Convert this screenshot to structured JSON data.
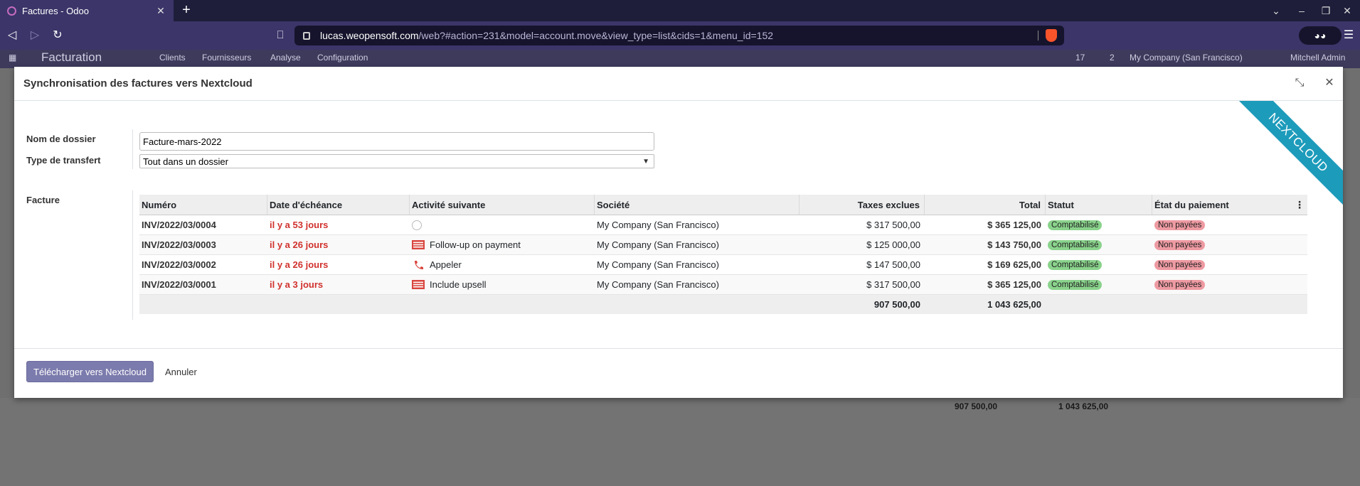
{
  "browser": {
    "tab_title": "Factures - Odoo",
    "url_host": "lucas.weopensoft.com",
    "url_path": "/web?#action=231&model=account.move&view_type=list&cids=1&menu_id=152"
  },
  "background": {
    "app_title": "Facturation",
    "menu": [
      "Clients",
      "Fournisseurs",
      "Analyse",
      "Configuration"
    ],
    "company": "My Company (San Francisco)",
    "user": "Mitchell Admin",
    "badge_activities": "17",
    "badge_messages": "2",
    "total_untaxed": "907 500,00",
    "total": "1 043 625,00"
  },
  "dialog": {
    "title": "Synchronisation des factures vers Nextcloud",
    "ribbon": "NEXTCLOUD",
    "folder_label": "Nom de dossier",
    "folder_value": "Facture-mars-2022",
    "transfer_label": "Type de transfert",
    "transfer_value": "Tout dans un dossier",
    "invoice_label": "Facture",
    "upload_button": "Télécharger vers Nextcloud",
    "cancel_button": "Annuler"
  },
  "table": {
    "columns": [
      "Numéro",
      "Date d'échéance",
      "Activité suivante",
      "Société",
      "Taxes exclues",
      "Total",
      "Statut",
      "État du paiement"
    ],
    "rows": [
      {
        "number": "INV/2022/03/0004",
        "due": "il y a 53 jours",
        "activity": "",
        "activity_icon": "clock-icon",
        "company": "My Company (San Francisco)",
        "untaxed": "$ 317 500,00",
        "total": "$ 365 125,00",
        "status": "Comptabilisé",
        "payment": "Non payées"
      },
      {
        "number": "INV/2022/03/0003",
        "due": "il y a 26 jours",
        "activity": "Follow-up on payment",
        "activity_icon": "email-icon",
        "company": "My Company (San Francisco)",
        "untaxed": "$ 125 000,00",
        "total": "$ 143 750,00",
        "status": "Comptabilisé",
        "payment": "Non payées"
      },
      {
        "number": "INV/2022/03/0002",
        "due": "il y a 26 jours",
        "activity": "Appeler",
        "activity_icon": "phone-icon",
        "company": "My Company (San Francisco)",
        "untaxed": "$ 147 500,00",
        "total": "$ 169 625,00",
        "status": "Comptabilisé",
        "payment": "Non payées"
      },
      {
        "number": "INV/2022/03/0001",
        "due": "il y a 3 jours",
        "activity": "Include upsell",
        "activity_icon": "email-icon",
        "company": "My Company (San Francisco)",
        "untaxed": "$ 317 500,00",
        "total": "$ 365 125,00",
        "status": "Comptabilisé",
        "payment": "Non payées"
      }
    ],
    "footer_untaxed": "907 500,00",
    "footer_total": "1 043 625,00"
  },
  "colors": {
    "accent": "#7c7bad",
    "ribbon": "#1d9bbb",
    "overdue": "#d0312d",
    "status_green": "#8ad38c",
    "status_red": "#ee9aa2"
  }
}
